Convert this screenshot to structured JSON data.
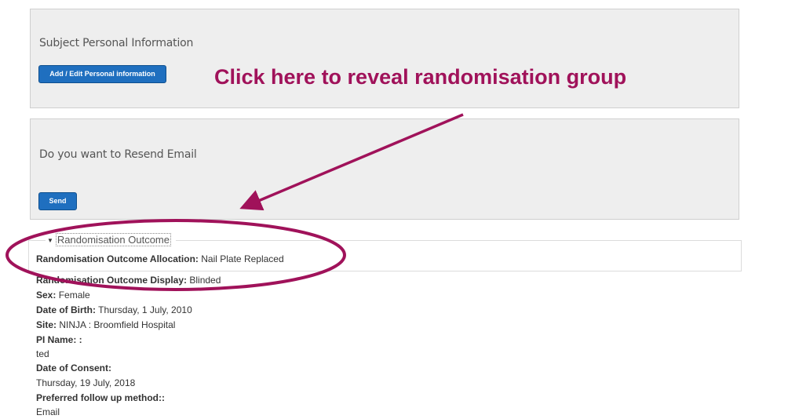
{
  "personal_panel": {
    "title": "Subject Personal Information",
    "button_label": "Add / Edit Personal information"
  },
  "resend_panel": {
    "title": "Do you want to Resend Email",
    "button_label": "Send"
  },
  "annotation": {
    "text": "Click here to reveal randomisation group",
    "color": "#a0125a"
  },
  "randomisation": {
    "legend": "Randomisation Outcome",
    "allocation_label": "Randomisation Outcome Allocation:",
    "allocation_value": "Nail Plate Replaced"
  },
  "details": {
    "display_label": "Randomisation Outcome Display:",
    "display_value": "Blinded",
    "sex_label": "Sex:",
    "sex_value": "Female",
    "dob_label": "Date of Birth:",
    "dob_value": "Thursday, 1 July, 2010",
    "site_label": "Site:",
    "site_value": "NINJA : Broomfield Hospital",
    "pi_label": "PI Name: :",
    "pi_value": "ted",
    "consent_label": "Date of Consent:",
    "consent_value": "Thursday, 19 July, 2018",
    "followup_label": "Preferred follow up method::",
    "followup_value": "Email"
  },
  "colors": {
    "button": "#1f6fbf",
    "panel": "#eeeeee"
  }
}
